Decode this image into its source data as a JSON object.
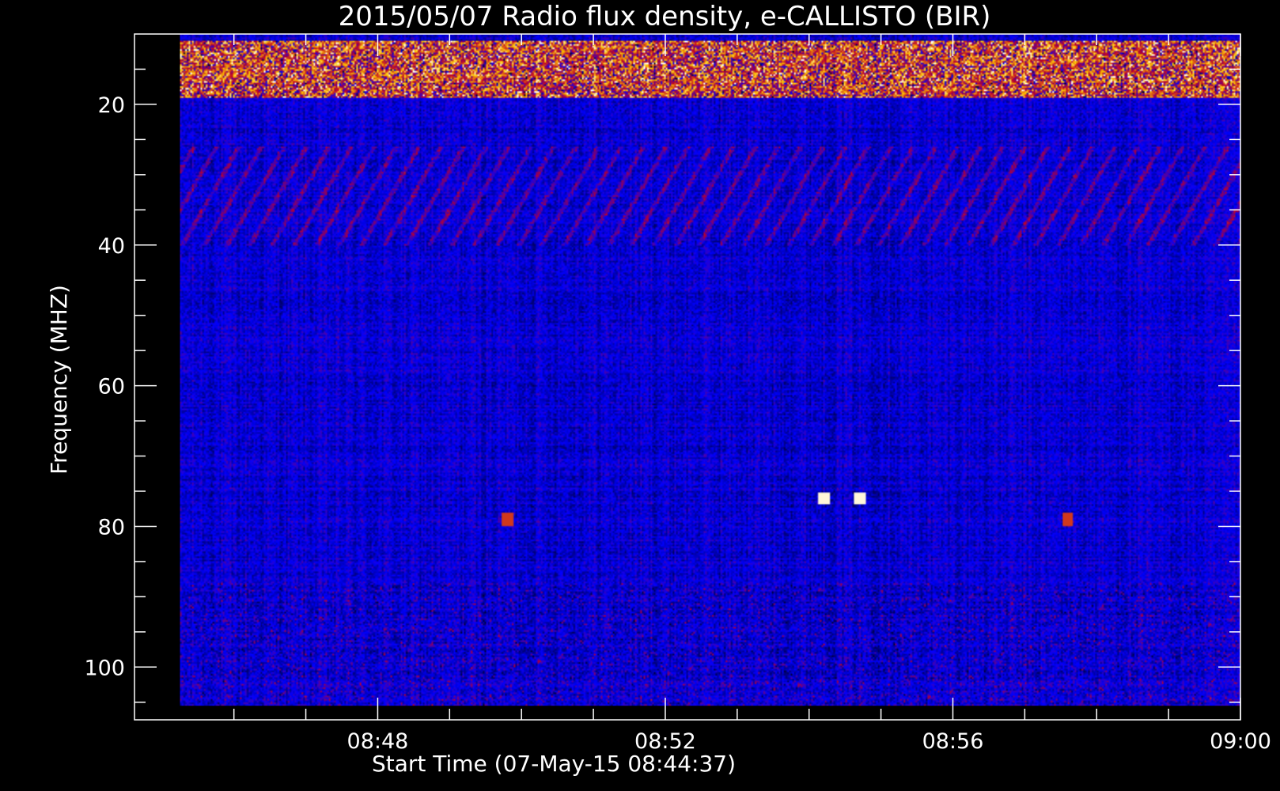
{
  "chart_data": {
    "type": "heatmap",
    "title": "2015/05/07  Radio flux density, e-CALLISTO (BIR)",
    "xlabel": "Start Time (07-May-15 08:44:37)",
    "ylabel": "Frequency (MHZ)",
    "x_ticks": [
      {
        "value": 48,
        "label": "08:48"
      },
      {
        "value": 52,
        "label": "08:52"
      },
      {
        "value": 56,
        "label": "08:56"
      },
      {
        "value": 60,
        "label": "09:00"
      }
    ],
    "y_ticks": [
      {
        "value": 20,
        "label": "20"
      },
      {
        "value": 40,
        "label": "40"
      },
      {
        "value": 60,
        "label": "60"
      },
      {
        "value": 80,
        "label": "80"
      },
      {
        "value": 100,
        "label": "100"
      }
    ],
    "x_minor_step": 1,
    "y_minor_step": 5,
    "xlim": [
      44.617,
      60
    ],
    "data_xlim": [
      45.25,
      60
    ],
    "ylim": [
      107.5,
      10
    ],
    "data_ylim": [
      105.5,
      10
    ],
    "colormap": "black-blue-red-yellow-white",
    "colors": {
      "background": "#000000",
      "low": "#0000ff",
      "mid": "#c01010",
      "high": "#ffd000",
      "peak": "#ffffff"
    },
    "features": [
      {
        "kind": "intense band",
        "freq_range": [
          11,
          19
        ],
        "intensity": "high"
      },
      {
        "kind": "drifting stripes",
        "freq_range": [
          26,
          40
        ],
        "drift": "high-to-low frequency"
      },
      {
        "kind": "spot",
        "time": 54.2,
        "freq": 76,
        "intensity": "peak"
      },
      {
        "kind": "spot",
        "time": 54.7,
        "freq": 76,
        "intensity": "peak"
      },
      {
        "kind": "spot",
        "time": 49.8,
        "freq": 79,
        "intensity": "mid"
      },
      {
        "kind": "spot",
        "time": 57.6,
        "freq": 79,
        "intensity": "mid"
      }
    ]
  }
}
